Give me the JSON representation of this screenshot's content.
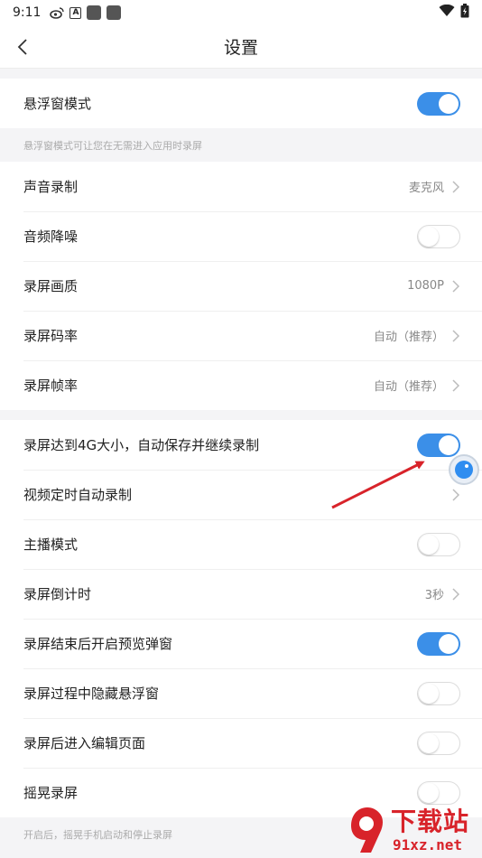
{
  "status_bar": {
    "time": "9:11",
    "weibo_icon": "weibo-icon",
    "a_icon": "A"
  },
  "header": {
    "title": "设置"
  },
  "section1": {
    "float_mode": {
      "label": "悬浮窗模式",
      "enabled": true
    },
    "hint": "悬浮窗模式可让您在无需进入应用时录屏"
  },
  "section2": {
    "items": [
      {
        "label": "声音录制",
        "value": "麦克风"
      },
      {
        "label": "音频降噪",
        "enabled": false
      },
      {
        "label": "录屏画质",
        "value": "1080P"
      },
      {
        "label": "录屏码率",
        "value": "自动（推荐）"
      },
      {
        "label": "录屏帧率",
        "value": "自动（推荐）"
      }
    ]
  },
  "section3": {
    "items": [
      {
        "label": "录屏达到4G大小，自动保存并继续录制",
        "enabled": true
      },
      {
        "label": "视频定时自动录制"
      },
      {
        "label": "主播模式",
        "enabled": false
      },
      {
        "label": "录屏倒计时",
        "value": "3秒"
      },
      {
        "label": "录屏结束后开启预览弹窗",
        "enabled": true
      },
      {
        "label": "录屏过程中隐藏悬浮窗",
        "enabled": false
      },
      {
        "label": "录屏后进入编辑页面",
        "enabled": false
      },
      {
        "label": "摇晃录屏",
        "enabled": false
      }
    ],
    "hint": "开启后，摇晃手机启动和停止录屏"
  },
  "watermark": {
    "title": "下载站",
    "url": "91xz.net"
  },
  "colors": {
    "accent": "#3b8fe8",
    "arrow": "#d8232a",
    "watermark": "#d8232a"
  }
}
